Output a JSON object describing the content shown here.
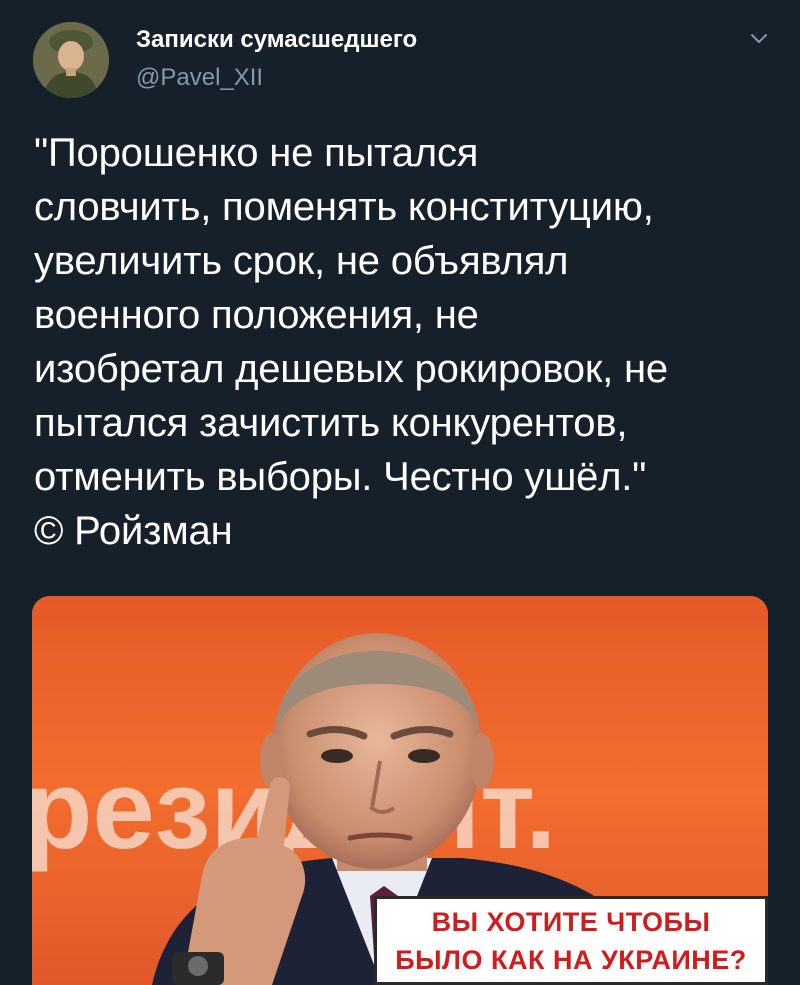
{
  "author": {
    "display_name": "Записки сумасшедшего",
    "handle": "@Pavel_XII",
    "avatar_icon": "user-avatar"
  },
  "menu": {
    "icon": "chevron-down-icon"
  },
  "tweet": {
    "text": "\"Порошенко не пытался\nсловчить, поменять конституцию,\nувеличить срок, не объявлял\nвоенного положения, не\nизобретал дешевых рокировок, не\nпытался зачистить конкурентов,\nотменить выборы. Честно ушёл.\"\n© Ройзман"
  },
  "media": {
    "caption_line1": "ВЫ ХОТИТЕ ЧТОБЫ",
    "caption_line2": "БЫЛО КАК НА УКРАИНЕ?",
    "background_text": "резидент.",
    "colors": {
      "backdrop": "#ee662c",
      "caption_text": "#d01c1c"
    }
  },
  "colors": {
    "background": "#15202b",
    "name": "#ffffff",
    "handle": "#8899a6"
  }
}
